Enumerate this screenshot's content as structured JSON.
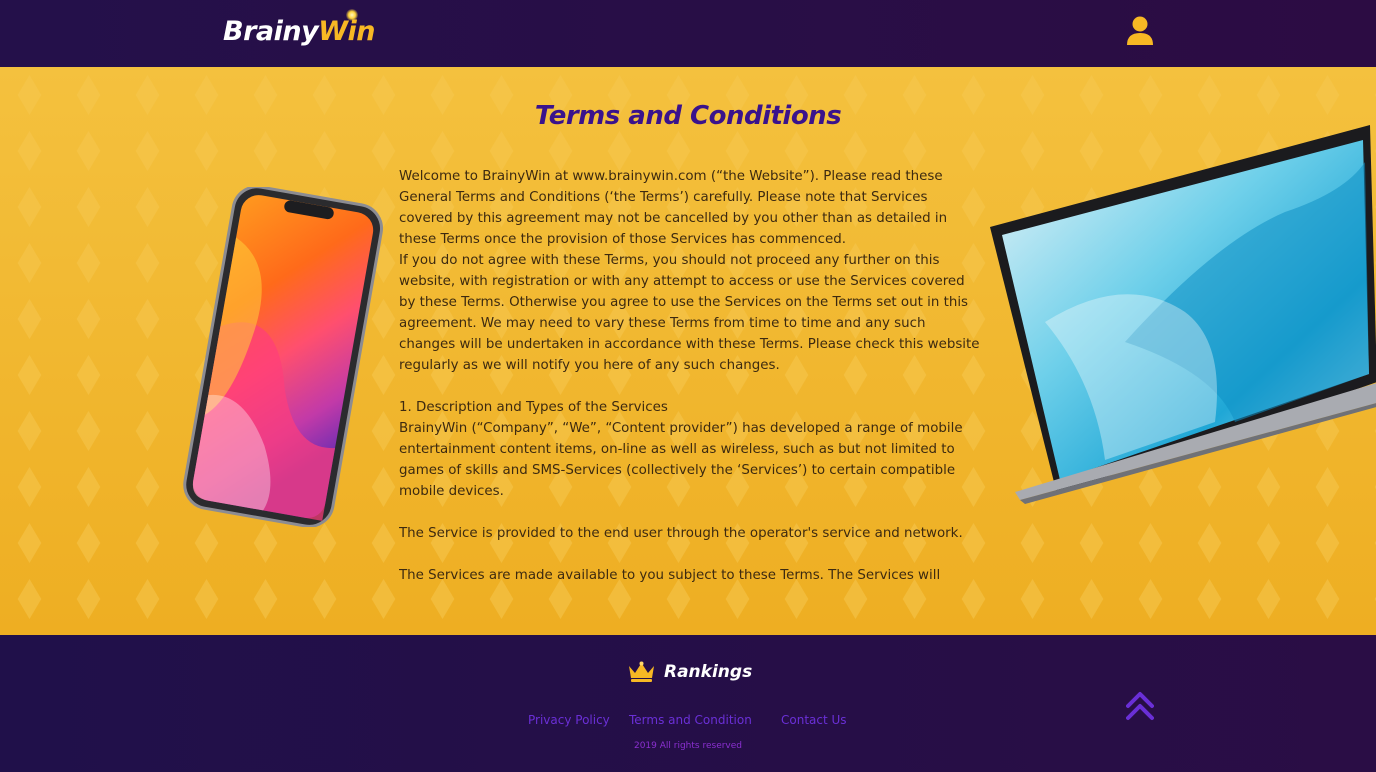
{
  "header": {
    "logo_brainy": "Brainy",
    "logo_win": "Win",
    "user_icon": "user-icon"
  },
  "main": {
    "title": "Terms and Conditions",
    "paragraphs": [
      "Welcome to BrainyWin at www.brainywin.com (“the Website”). Please read these General Terms and Conditions (‘the Terms’) carefully. Please note that Services covered by this agreement may not be cancelled by you other than as detailed in these Terms once the provision of those Services has commenced.",
      "If you do not agree with these Terms, you should not proceed any further on this website, with registration or with any attempt to access or use the Services covered by these Terms. Otherwise you agree to use the Services on the Terms set out in this agreement. We may need to vary these Terms from time to time and any such changes will be undertaken in accordance with these Terms. Please check this website regularly as we will notify you here of any such changes.",
      "1. Description and Types of the Services",
      "BrainyWin (“Company”, “We”, “Content provider”) has developed a range of mobile entertainment content items, on-line as well as wireless, such as but not limited to games of skills and SMS-Services (collectively the ‘Services’) to certain compatible mobile devices.",
      "The Service is provided to the end user through the operator's service and network.",
      "The Services are made available to you subject to these Terms. The Services will"
    ]
  },
  "footer": {
    "rankings_label": "Rankings",
    "links": {
      "privacy": "Privacy Policy",
      "terms": "Terms and Condition",
      "contact": "Contact Us"
    },
    "copyright": "2019 All rights reserved"
  },
  "colors": {
    "header_bg": "#24104a",
    "accent_gold": "#f7b824",
    "title_purple": "#3a138c",
    "link_purple": "#6a2fd6"
  }
}
